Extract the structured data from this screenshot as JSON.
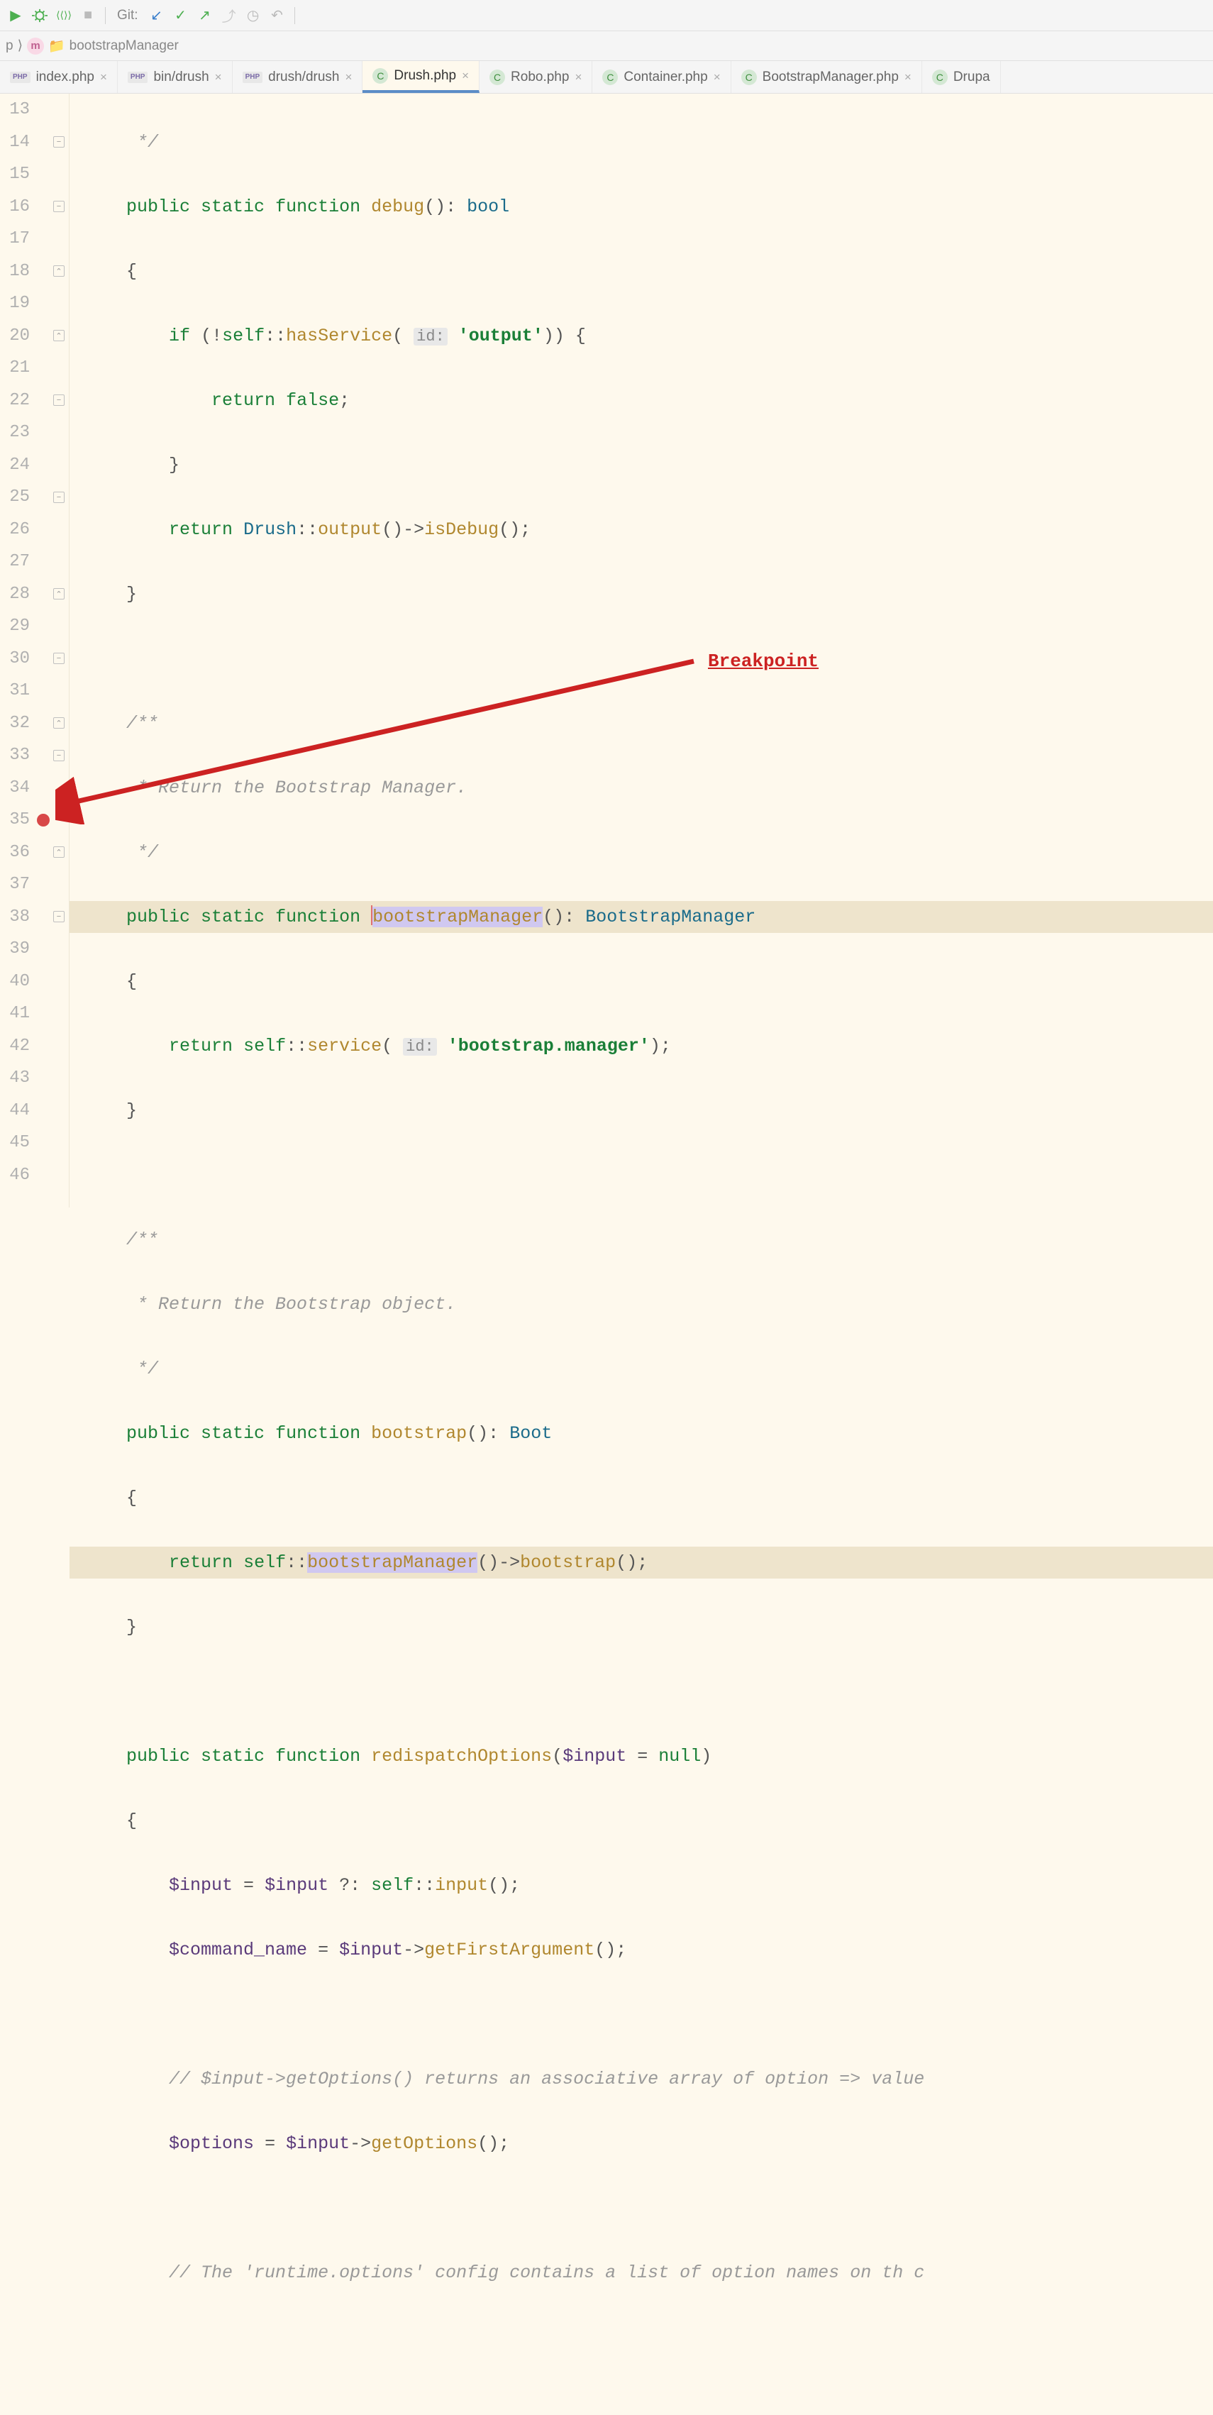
{
  "toolbar": {
    "git_label": "Git:"
  },
  "breadcrumb": {
    "item1": "p",
    "item2": "m",
    "func_name": "bootstrapManager"
  },
  "tabs": [
    {
      "label": "index.php",
      "type": "php"
    },
    {
      "label": "bin/drush",
      "type": "php"
    },
    {
      "label": "drush/drush",
      "type": "php"
    },
    {
      "label": "Drush.php",
      "type": "c",
      "active": true
    },
    {
      "label": "Robo.php",
      "type": "c"
    },
    {
      "label": "Container.php",
      "type": "c"
    },
    {
      "label": "BootstrapManager.php",
      "type": "c"
    },
    {
      "label": "Drupa",
      "type": "c",
      "partial": true
    }
  ],
  "lines": {
    "start": 13,
    "end": 46
  },
  "code": {
    "l13": "     */",
    "l14_public": "public",
    "l14_static": "static",
    "l14_function": "function",
    "l14_debug": "debug",
    "l14_bool": "bool",
    "l15": "{",
    "l16_if": "if",
    "l16_self": "self",
    "l16_has": "hasService",
    "l16_hint": "id:",
    "l16_str": "'output'",
    "l17_return": "return",
    "l17_false": "false",
    "l18": "}",
    "l19_return": "return",
    "l19_drush": "Drush",
    "l19_output": "output",
    "l19_isdebug": "isDebug",
    "l20": "}",
    "l22_a": "/**",
    "l23": " * Return the Bootstrap Manager.",
    "l24": " */",
    "l25_public": "public",
    "l25_static": "static",
    "l25_function": "function",
    "l25_bm": "bootstrapManager",
    "l25_type": "BootstrapManager",
    "l26": "{",
    "l27_return": "return",
    "l27_self": "self",
    "l27_service": "service",
    "l27_hint": "id:",
    "l27_str": "'bootstrap.manager'",
    "l28": "}",
    "l30_a": "/**",
    "l31": " * Return the Bootstrap object.",
    "l32": " */",
    "l33_public": "public",
    "l33_static": "static",
    "l33_function": "function",
    "l33_bs": "bootstrap",
    "l33_type": "Boot",
    "l34": "{",
    "l35_return": "return",
    "l35_self": "self",
    "l35_bm": "bootstrapManager",
    "l35_bs": "bootstrap",
    "l36": "}",
    "l38_public": "public",
    "l38_static": "static",
    "l38_function": "function",
    "l38_ro": "redispatchOptions",
    "l38_input": "$input",
    "l38_null": "null",
    "l39": "{",
    "l40_input": "$input",
    "l40_eq": " = ",
    "l40_input2": "$input",
    "l40_q": " ?: ",
    "l40_self": "self",
    "l40_inputfn": "input",
    "l41_cmd": "$command_name",
    "l41_input": "$input",
    "l41_gfa": "getFirstArgument",
    "l43": "// $input->getOptions() returns an associative array of option => value",
    "l44_opt": "$options",
    "l44_input": "$input",
    "l44_go": "getOptions",
    "l46": "// The 'runtime.options' config contains a list of option names on th c"
  },
  "annotation": {
    "label": "Breakpoint"
  }
}
